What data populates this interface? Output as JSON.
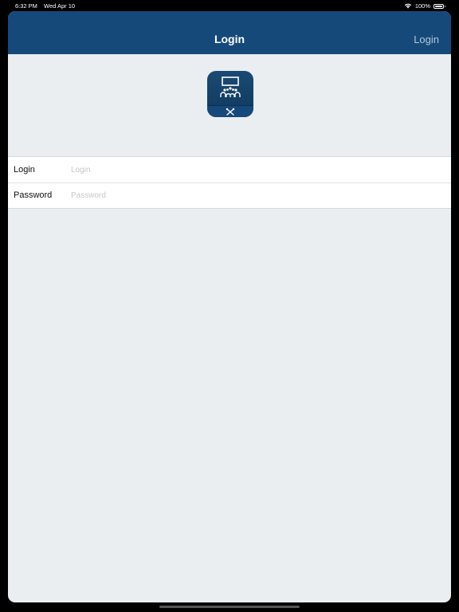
{
  "status_bar": {
    "time": "6:32 PM",
    "date": "Wed Apr 10",
    "battery": "100%",
    "wifi_icon": "wifi-icon",
    "battery_icon": "battery-icon"
  },
  "nav": {
    "title": "Login",
    "action_label": "Login"
  },
  "logo": {
    "icon": "app-logo-icon",
    "colors": {
      "primary": "#15497a",
      "accent": "#ffffff"
    }
  },
  "form": {
    "login": {
      "label": "Login",
      "placeholder": "Login",
      "value": ""
    },
    "password": {
      "label": "Password",
      "placeholder": "Password",
      "value": ""
    }
  },
  "colors": {
    "nav_background": "#15497a",
    "page_background": "#eaeef0",
    "nav_action_text": "#b6c7d8"
  }
}
